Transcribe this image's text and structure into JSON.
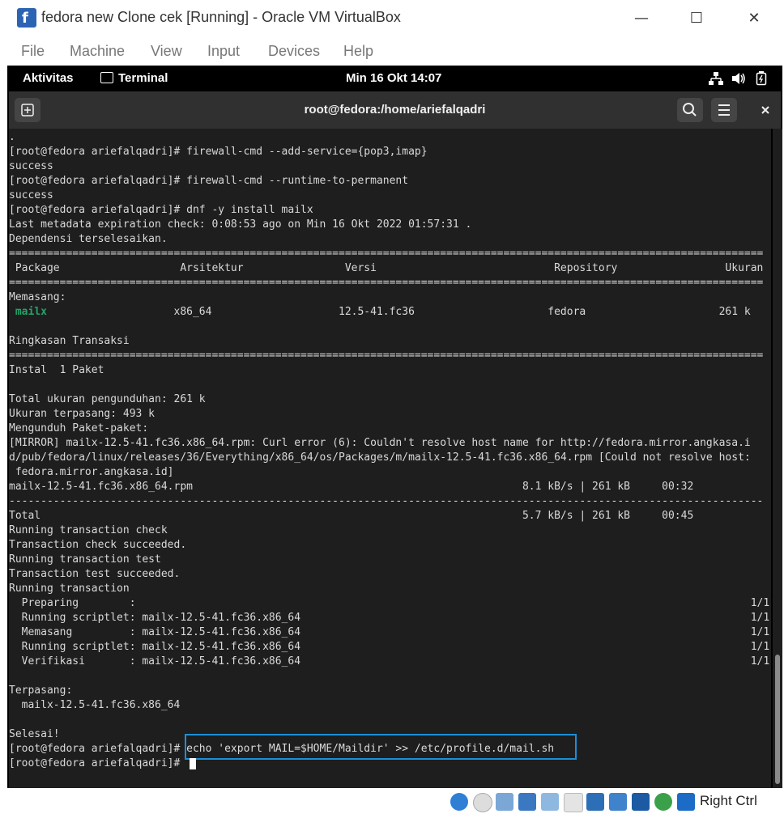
{
  "window": {
    "title": "fedora new Clone cek [Running] - Oracle VM VirtualBox",
    "minimize": "—",
    "maximize": "☐",
    "close": "✕"
  },
  "menu": [
    "File",
    "Machine",
    "View",
    "Input",
    "Devices",
    "Help"
  ],
  "gnome": {
    "activities": "Aktivitas",
    "app": "Terminal",
    "clock": "Min 16 Okt  14:07"
  },
  "terminal": {
    "title": "root@fedora:/home/ariefalqadri",
    "lines": [
      ".",
      "[root@fedora ariefalqadri]# firewall-cmd --add-service={pop3,imap}",
      "success",
      "[root@fedora ariefalqadri]# firewall-cmd --runtime-to-permanent",
      "success",
      "[root@fedora ariefalqadri]# dnf -y install mailx",
      "Last metadata expiration check: 0:08:53 ago on Min 16 Okt 2022 01:57:31 .",
      "Dependensi terselesaikan.",
      "=======================================================================================================================",
      " Package                   Arsitektur                Versi                            Repository                 Ukuran",
      "=======================================================================================================================",
      "Memasang:",
      " mailx                    x86_64                    12.5-41.fc36                     fedora                     261 k",
      "",
      "Ringkasan Transaksi",
      "=======================================================================================================================",
      "Instal  1 Paket",
      "",
      "Total ukuran pengunduhan: 261 k",
      "Ukuran terpasang: 493 k",
      "Mengunduh Paket-paket:",
      "[MIRROR] mailx-12.5-41.fc36.x86_64.rpm: Curl error (6): Couldn't resolve host name for http://fedora.mirror.angkasa.i",
      "d/pub/fedora/linux/releases/36/Everything/x86_64/os/Packages/m/mailx-12.5-41.fc36.x86_64.rpm [Could not resolve host:",
      " fedora.mirror.angkasa.id]",
      "mailx-12.5-41.fc36.x86_64.rpm                                                    8.1 kB/s | 261 kB     00:32",
      "-----------------------------------------------------------------------------------------------------------------------",
      "Total                                                                            5.7 kB/s | 261 kB     00:45",
      "Running transaction check",
      "Transaction check succeeded.",
      "Running transaction test",
      "Transaction test succeeded.",
      "Running transaction",
      "  Preparing        :                                                                                                 1/1",
      "  Running scriptlet: mailx-12.5-41.fc36.x86_64                                                                       1/1",
      "  Memasang         : mailx-12.5-41.fc36.x86_64                                                                       1/1",
      "  Running scriptlet: mailx-12.5-41.fc36.x86_64                                                                       1/1",
      "  Verifikasi       : mailx-12.5-41.fc36.x86_64                                                                       1/1",
      "",
      "Terpasang:",
      "  mailx-12.5-41.fc36.x86_64",
      "",
      "Selesai!",
      "[root@fedora ariefalqadri]# echo 'export MAIL=$HOME/Maildir' >> /etc/profile.d/mail.sh",
      "[root@fedora ariefalqadri]# "
    ],
    "highlight_color": "#1e8ed6"
  },
  "statusbar": {
    "right_ctrl": "Right Ctrl",
    "icons": [
      "hard-disk-icon",
      "optical-disk-icon",
      "audio-icon",
      "network-icon",
      "usb-icon",
      "shared-folder-icon",
      "display-icon",
      "recording-icon",
      "cpu-icon",
      "mouse-integration-icon",
      "keyboard-icon"
    ]
  }
}
